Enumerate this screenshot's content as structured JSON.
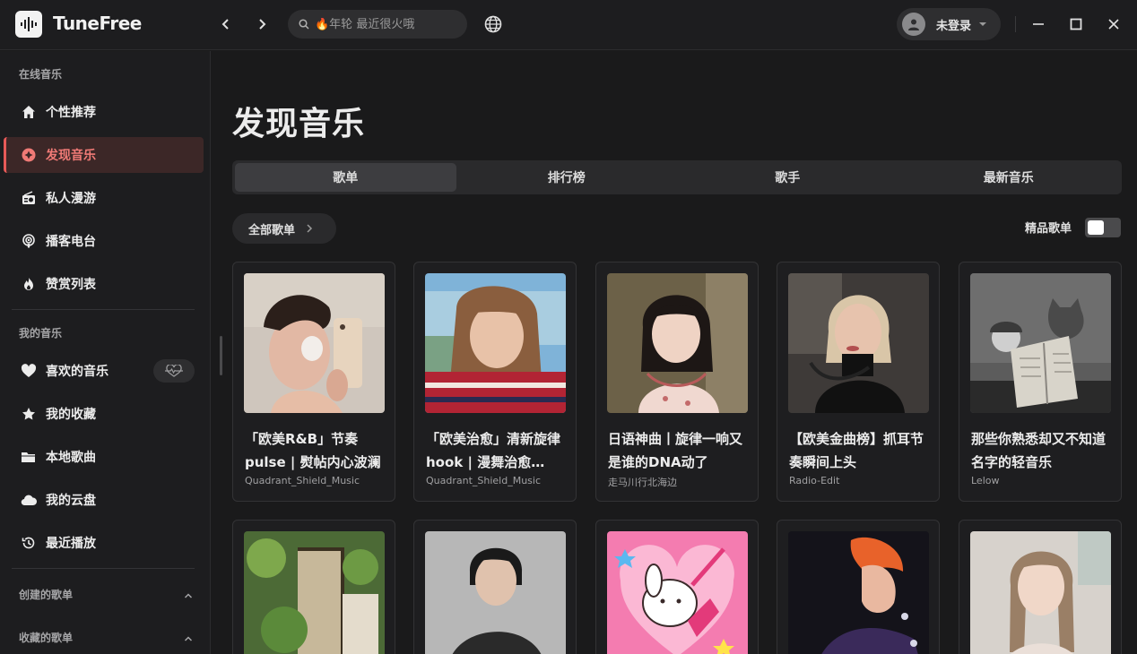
{
  "app": {
    "name": "TuneFree"
  },
  "search": {
    "placeholder": "🔥年轮 最近很火哦"
  },
  "user": {
    "name": "未登录"
  },
  "sidebar": {
    "online_label": "在线音乐",
    "online_items": [
      {
        "label": "个性推荐",
        "icon": "home-icon"
      },
      {
        "label": "发现音乐",
        "icon": "disc-icon",
        "active": true
      },
      {
        "label": "私人漫游",
        "icon": "radio-icon"
      },
      {
        "label": "播客电台",
        "icon": "podcast-icon"
      },
      {
        "label": "赞赏列表",
        "icon": "flame-icon"
      }
    ],
    "my_label": "我的音乐",
    "my_items": [
      {
        "label": "喜欢的音乐",
        "icon": "heart-icon"
      },
      {
        "label": "我的收藏",
        "icon": "star-icon"
      },
      {
        "label": "本地歌曲",
        "icon": "folder-icon"
      },
      {
        "label": "我的云盘",
        "icon": "cloud-icon"
      },
      {
        "label": "最近播放",
        "icon": "history-icon"
      }
    ],
    "created_label": "创建的歌单",
    "collected_label": "收藏的歌单"
  },
  "main": {
    "title": "发现音乐",
    "tabs": [
      "歌单",
      "排行榜",
      "歌手",
      "最新音乐"
    ],
    "active_tab": 0,
    "all_playlists": "全部歌单",
    "quality_label": "精品歌单",
    "quality_toggle": false,
    "playlists": [
      {
        "title": "「欧美R&B」节奏pulse | 熨帖内心波澜",
        "author": "Quadrant_Shield_Music"
      },
      {
        "title": "「欧美治愈」清新旋律hook | 漫舞治愈…",
        "author": "Quadrant_Shield_Music"
      },
      {
        "title": "日语神曲丨旋律一响又是谁的DNA动了",
        "author": "走马川行北海边"
      },
      {
        "title": "【欧美金曲榜】抓耳节奏瞬间上头",
        "author": "Radio-Edit"
      },
      {
        "title": "那些你熟悉却又不知道名字的轻音乐",
        "author": "Lelow"
      }
    ]
  },
  "colors": {
    "accent": "#e85a58",
    "background": "#1a1a1b",
    "sidebar": "#1d1d1f"
  }
}
